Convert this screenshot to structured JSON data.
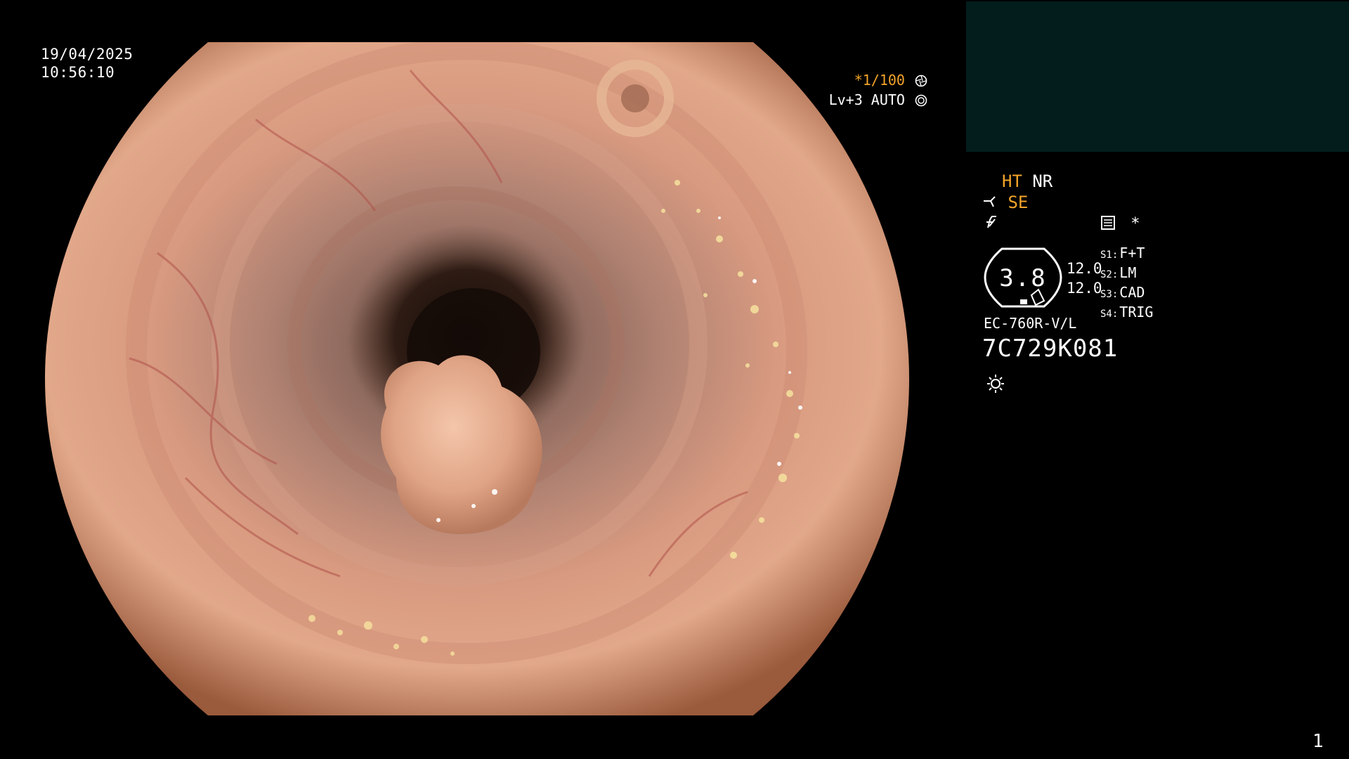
{
  "overlay": {
    "date": "19/04/2025",
    "time": "10:56:10",
    "shutter": "*1/100",
    "level": "Lv+3 AUTO"
  },
  "processor_panel": {
    "mode_ht": "HT",
    "mode_nr": "NR",
    "se_label": "SE",
    "asterisk": "*",
    "gauge_value": "3.8",
    "zoom_values": [
      "12.0",
      "12.0"
    ],
    "switches": [
      {
        "key": "S1:",
        "value": "F+T"
      },
      {
        "key": "S2:",
        "value": "LM"
      },
      {
        "key": "S3:",
        "value": "CAD"
      },
      {
        "key": "S4:",
        "value": "TRIG"
      }
    ],
    "scope_model": "EC-760R-V/L",
    "scope_serial": "7C729K081"
  },
  "page_number": "1",
  "colors": {
    "accent": "#f3a42a",
    "thumbnail_bg": "#031d1d",
    "mucosa": "#d9957c"
  },
  "icons": [
    "aperture-icon",
    "iris-icon",
    "scope-tip-icon",
    "freeze-icon",
    "memo-icon",
    "light-icon"
  ]
}
